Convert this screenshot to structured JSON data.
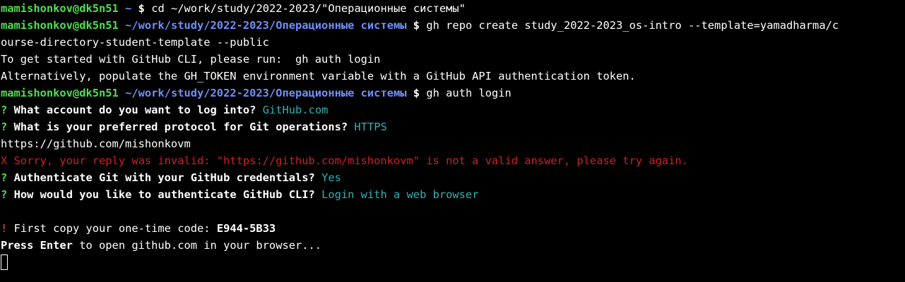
{
  "prompt": {
    "user_host": "mamishonkov@dk5n51",
    "home_path": "~",
    "work_path": "~/work/study/2022-2023/Операционные системы",
    "symbol": "$"
  },
  "lines": {
    "l1_cmd": "cd ~/work/study/2022-2023/\"Операционные системы\"",
    "l2_cmd": "gh repo create study_2022-2023_os-intro --template=yamadharma/c",
    "l3_cont": "ourse-directory-student-template --public",
    "l4_out": "To get started with GitHub CLI, please run:  gh auth login",
    "l5_out": "Alternatively, populate the GH_TOKEN environment variable with a GitHub API authentication token.",
    "l6_cmd": "gh auth login",
    "q_mark": "?",
    "q1_text": "What account do you want to log into?",
    "q1_answer": "GitHub.com",
    "q2_text": "What is your preferred protocol for Git operations?",
    "q2_answer": "HTTPS",
    "typed_url": "https://github.com/mishonkovm",
    "error_text": "X Sorry, your reply was invalid: \"https://github.com/mishonkovm\" is not a valid answer, please try again.",
    "q3_text": "Authenticate Git with your GitHub credentials?",
    "q3_answer": "Yes",
    "q4_text": "How would you like to authenticate GitHub CLI?",
    "q4_answer": "Login with a web browser",
    "warn_mark": "!",
    "code_label": "First copy your one-time code:",
    "code_value": "E944-5B33",
    "press_enter": "Press Enter",
    "press_rest": "to open github.com in your browser..."
  },
  "colors": {
    "background": "#000000",
    "user": "#4ee04e",
    "path": "#6f8ff8",
    "answer": "#2fb3b3",
    "error": "#cc2222",
    "warn": "#e2562a"
  }
}
